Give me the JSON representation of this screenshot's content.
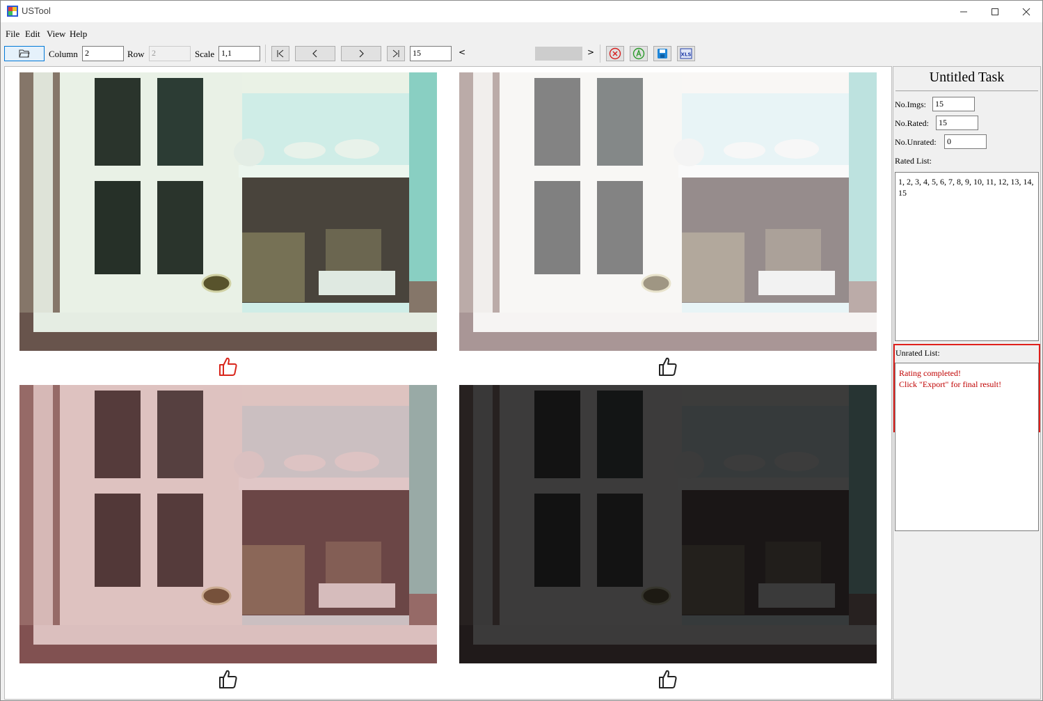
{
  "window": {
    "title": "USTool"
  },
  "menu": [
    "File",
    "Edit",
    "View",
    "Help"
  ],
  "toolbar": {
    "column_label": "Column",
    "column_value": "2",
    "row_label": "Row",
    "row_value": "2",
    "scale_label": "Scale",
    "scale_value": "1,1",
    "page_value": "15",
    "scroll_left": "<",
    "scroll_right": ">"
  },
  "images": [
    {
      "tone": "saturated",
      "liked": true
    },
    {
      "tone": "bright",
      "liked": false
    },
    {
      "tone": "reddish",
      "liked": false
    },
    {
      "tone": "dark",
      "liked": false
    }
  ],
  "panel": {
    "task_title": "Untitled Task",
    "no_imgs_label": "No.Imgs:",
    "no_imgs": "15",
    "no_rated_label": "No.Rated:",
    "no_rated": "15",
    "no_unrated_label": "No.Unrated:",
    "no_unrated": "0",
    "rated_list_label": "Rated List:",
    "rated_list": "1, 2, 3, 4, 5, 6, 7, 8, 9, 10, 11, 12, 13, 14, 15",
    "unrated_list_label": "Unrated List:",
    "status_line1": "Rating completed!",
    "status_line2": "Click \"Export\" for final result!"
  },
  "colors": {
    "highlight_red": "#e0201c",
    "status_red": "#c00000",
    "like_red": "#d9261c"
  }
}
